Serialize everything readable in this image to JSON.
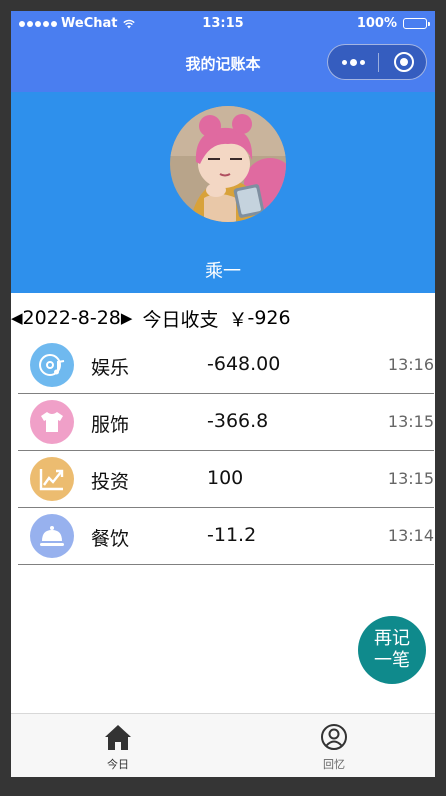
{
  "status_bar": {
    "carrier": "WeChat",
    "time": "13:15",
    "battery": "100%"
  },
  "nav": {
    "title": "我的记账本"
  },
  "profile": {
    "username": "乘一"
  },
  "summary": {
    "prev_arrow": "◀",
    "date": "2022-8-28",
    "next_arrow": "▶",
    "label": "今日收支",
    "currency": "￥",
    "total": "-926"
  },
  "records": [
    {
      "icon": "music-disc-icon",
      "color": "#6fb9ef",
      "category": "娱乐",
      "amount": "-648.00",
      "time": "13:16"
    },
    {
      "icon": "tshirt-icon",
      "color": "#f0a0c8",
      "category": "服饰",
      "amount": "-366.8",
      "time": "13:15"
    },
    {
      "icon": "trend-chart-icon",
      "color": "#ecbc70",
      "category": "投资",
      "amount": "100",
      "time": "13:15"
    },
    {
      "icon": "dish-cover-icon",
      "color": "#97b1ee",
      "category": "餐饮",
      "amount": "-11.2",
      "time": "13:14"
    }
  ],
  "fab": {
    "line1": "再记",
    "line2": "一笔",
    "color": "#0f8a8c"
  },
  "tabs": [
    {
      "icon": "home-icon",
      "label": "今日"
    },
    {
      "icon": "user-circle-icon",
      "label": "回忆"
    }
  ],
  "colors": {
    "nav": "#4a7ef0",
    "profile": "#2e90ec"
  }
}
